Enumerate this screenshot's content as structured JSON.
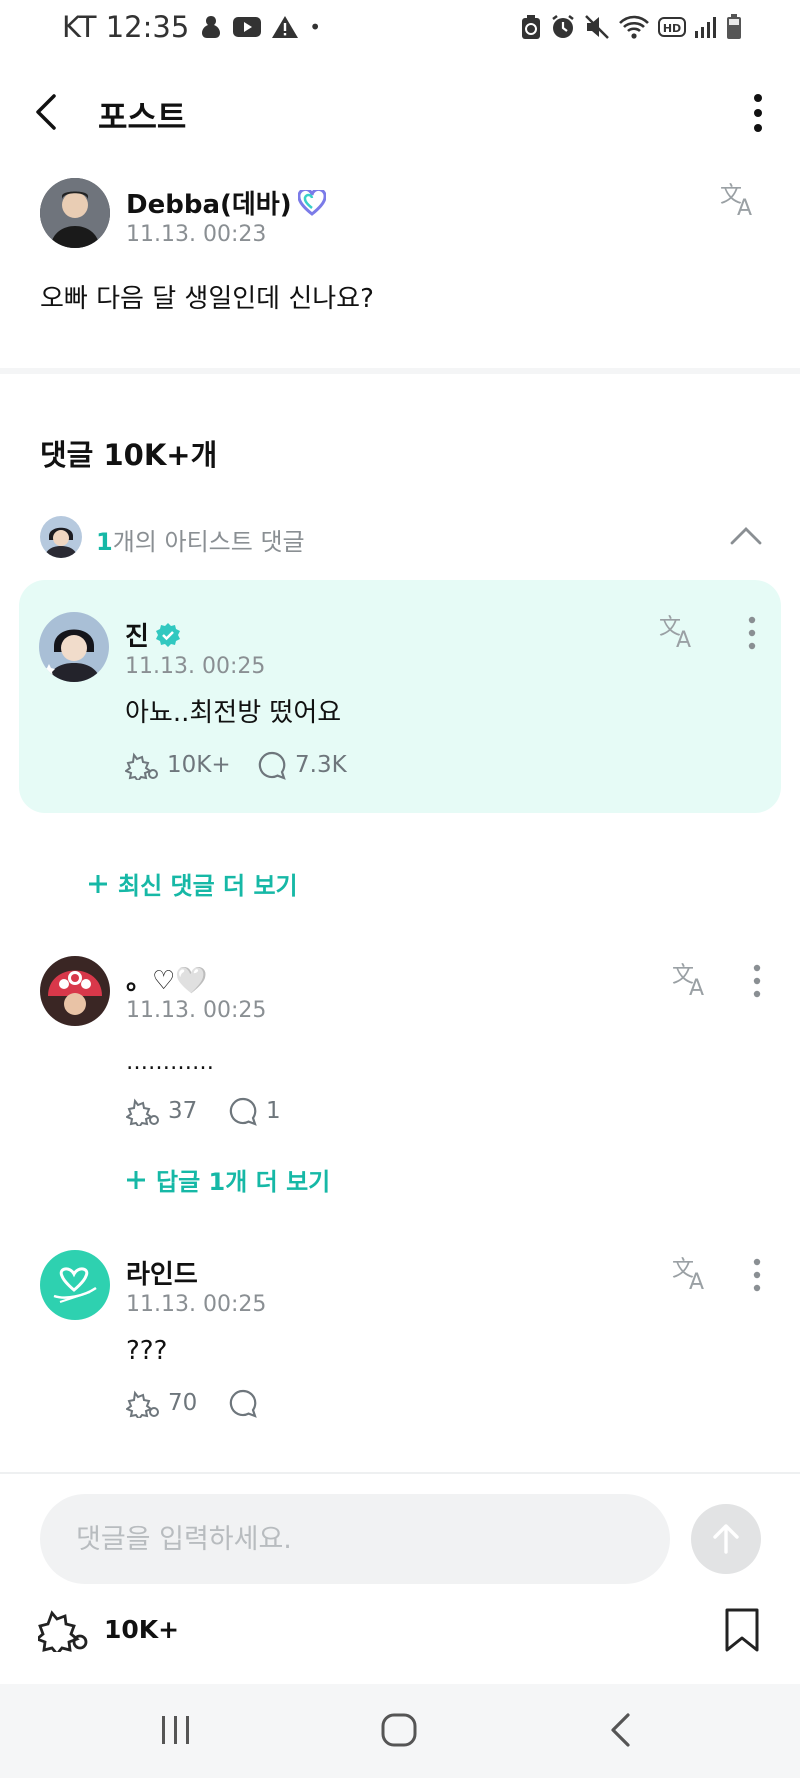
{
  "status_bar": {
    "carrier_time": "KT 12:35",
    "dot": "•",
    "icons": [
      "thread-icon",
      "youtube-icon",
      "warning-icon",
      "recycle-icon",
      "alarm-icon",
      "mute-icon",
      "wifi-icon",
      "hd-icon",
      "signal-icon",
      "battery-icon"
    ]
  },
  "header": {
    "title": "포스트"
  },
  "post": {
    "author": "Debba(데바)",
    "date": "11.13. 00:23",
    "text": "오빠 다음 달 생일인데 신나요?"
  },
  "comments_section": {
    "title": "댓글 10K+개",
    "artist_count": "1",
    "artist_label": "개의 아티스트 댓글"
  },
  "artist_comment": {
    "author": "진",
    "date": "11.13. 00:25",
    "text": "아뇨..최전방 떴어요",
    "likes": "10K+",
    "replies": "7.3K"
  },
  "more_latest": "최신 댓글 더 보기",
  "comments": [
    {
      "author": "。♡🤍",
      "date": "11.13. 00:25",
      "text": "…………",
      "likes": "37",
      "replies": "1",
      "more_replies": "답글 1개 더 보기"
    },
    {
      "author": "라인드",
      "date": "11.13. 00:25",
      "text": "???",
      "likes": "70",
      "replies": ""
    }
  ],
  "composer": {
    "placeholder": "댓글을 입력하세요.",
    "likes": "10K+"
  },
  "colors": {
    "accent": "#16b8a6",
    "card_bg": "#e6fbf6",
    "muted": "#8a8f93"
  }
}
